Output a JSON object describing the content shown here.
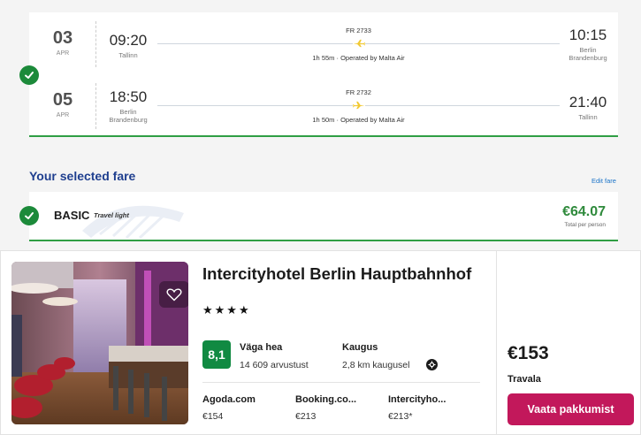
{
  "flights": [
    {
      "date_day": "03",
      "date_month": "APR",
      "dep_time": "09:20",
      "dep_city": "Tallinn",
      "flight_no": "FR 2733",
      "duration_info": "1h 55m · Operated by Malta Air",
      "arr_time": "10:15",
      "arr_city": "Berlin Brandenburg"
    },
    {
      "date_day": "05",
      "date_month": "APR",
      "dep_time": "18:50",
      "dep_city": "Berlin Brandenburg",
      "flight_no": "FR 2732",
      "duration_info": "1h 50m · Operated by Malta Air",
      "arr_time": "21:40",
      "arr_city": "Tallinn"
    }
  ],
  "fare": {
    "section_title": "Your selected fare",
    "edit_label": "Edit fare",
    "name": "BASIC",
    "tag": "Travel light",
    "price": "€64.07",
    "price_note": "Total per person"
  },
  "hotel": {
    "name": "Intercityhotel Berlin Hauptbahnhof",
    "stars": "★★★★",
    "rating_score": "8,1",
    "rating_label": "Väga hea",
    "rating_count": "14 609 arvustust",
    "distance_label": "Kaugus",
    "distance_value": "2,8 km kaugusel",
    "deals": [
      {
        "provider": "Agoda.com",
        "price": "€154"
      },
      {
        "provider": "Booking.co...",
        "price": "€213"
      },
      {
        "provider": "Intercityho...",
        "price": "€213*"
      }
    ],
    "best_price": "€153",
    "best_provider": "Travala",
    "cta_label": "Vaata pakkumist"
  },
  "colors": {
    "brand_blue": "#073590",
    "success_green": "#1c8a3a",
    "price_green": "#2f8a3c",
    "cta_magenta": "#c2185b",
    "rating_green": "#118a42"
  }
}
